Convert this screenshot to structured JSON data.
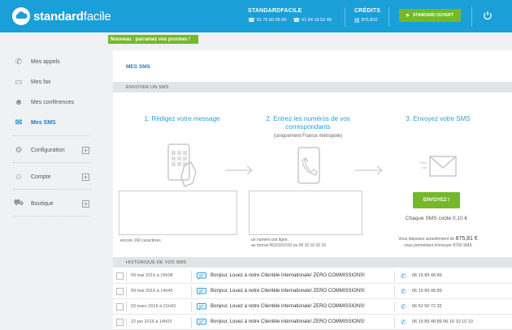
{
  "header": {
    "brand_bold": "standard",
    "brand_light": "facile",
    "standard_title": "STANDARDFACILE",
    "phone_1": "01 76 50 05 00",
    "phone_2": "01 84 10 52 49",
    "credits_title": "CRÉDITS",
    "credits_value": "875,81€",
    "status_button": "STANDARD OUVERT",
    "accent": "#1a9fd9",
    "green": "#76b82a"
  },
  "sidebar": {
    "items": [
      {
        "label": "Mes appels",
        "icon": "phone-icon"
      },
      {
        "label": "Mes fax",
        "icon": "fax-icon"
      },
      {
        "label": "Mes conférences",
        "icon": "conference-icon"
      },
      {
        "label": "Mes SMS",
        "icon": "sms-icon"
      },
      {
        "label": "Configuration",
        "icon": "configuration-icon"
      },
      {
        "label": "Compte",
        "icon": "account-icon"
      },
      {
        "label": "Boutique",
        "icon": "cart-icon"
      }
    ]
  },
  "news_banner": "Nouveau : parrainez vos proches !",
  "page": {
    "breadcrumb": "MES SMS",
    "send_section": "ENVOYER UN SMS",
    "step1_title": "1. Rédigez votre message",
    "step2_title_line1": "2. Entrez les numéros de vos",
    "step2_title_line2": "correspondants",
    "step2_sub": "(uniquement France métropole)",
    "step3_title": "3. Envoyez votre SMS",
    "message_hint": "encore 160 caractères",
    "numbers_hint_line1": "un numéro par ligne,",
    "numbers_hint_line2": "au format 0610101010 ou 06 10 10 10 10",
    "send_button": "ENVOYEZ !",
    "cost": "Chaque SMS coûte 0,10 €",
    "avail_prefix": "Vous disposez actuellement de",
    "avail_amount": "875,81 €",
    "avail_suffix": "vous permettant d'envoyer 8750 SMS",
    "history_section": "HISTORIQUE DE VOS SMS"
  },
  "history": [
    {
      "date": "09 mai 2016 à 15h08",
      "message": "Bonjour, Louez à notre Clientèle internationale! ZERO COMMISSIONS!",
      "numbers": "06 15 89 48 89"
    },
    {
      "date": "09 mai 2016 à 14h45",
      "message": "Bonjour, Louez à notre Clientèle internationale! ZERO COMMISSIONS!",
      "numbers": "06 15 89 48 89"
    },
    {
      "date": "03 mars 2016 à 21h43",
      "message": "Bonjour, Louez à notre Clientèle internationale! ZERO COMMISSIONS!",
      "numbers": "06 62 50 72 32"
    },
    {
      "date": "22 jan 2016 à 14h03",
      "message": "Bonjour, Louez à notre Clientèle internationale! ZERO COMMISSIONS!",
      "numbers": "06 15 89 48 89  06 10 10 10 10"
    }
  ]
}
